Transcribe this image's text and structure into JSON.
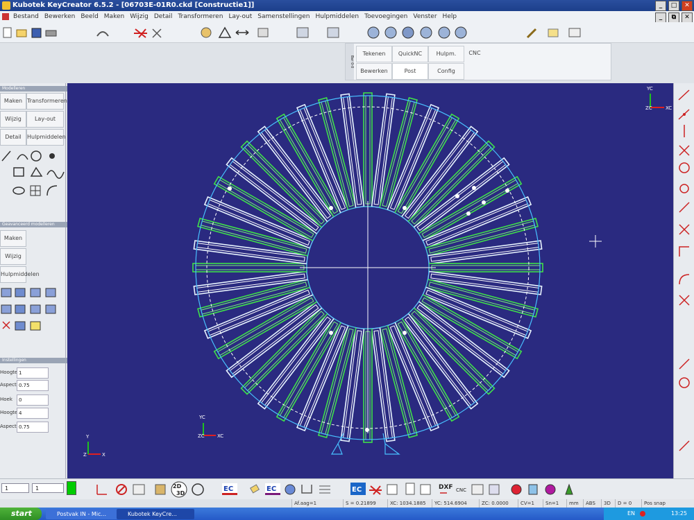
{
  "window": {
    "title": "Kubotek KeyCreator 6.5.2 - [06703E-01R0.ckd [Constructie1]]",
    "buttons": [
      "_",
      "□",
      "✕"
    ],
    "doc_buttons": [
      "_",
      "⧉",
      "✕"
    ]
  },
  "menu": [
    "Bestand",
    "Bewerken",
    "Beeld",
    "Maken",
    "Wijzig",
    "Detail",
    "Transformeren",
    "Lay-out",
    "Samenstellingen",
    "Hulpmiddelen",
    "Toevoegingen",
    "Venster",
    "Help"
  ],
  "tabs_panel": {
    "side_label": "Bar 0-0",
    "tabs": [
      "Tekenen",
      "QuickNC",
      "Hulpm.",
      "CNC",
      "Bewerken",
      "Post",
      "Config"
    ]
  },
  "left_panel": {
    "section1_title": "Modelleren",
    "section1_buttons": [
      "Maken",
      "Transformeren",
      "Wijzig",
      "Lay-out",
      "Detail",
      "Hulpmiddelen"
    ],
    "section2_title": "Geavanceerd modelleren",
    "section2_buttons": [
      "Maken",
      "Wijzig",
      "Hulpmiddelen"
    ],
    "section3_title": "Instellingen",
    "fields": [
      {
        "label": "Hoogte",
        "value": "1"
      },
      {
        "label": "Aspect",
        "value": "0.75"
      },
      {
        "label": "Hoek",
        "value": "0"
      },
      {
        "label": "Hoogte",
        "value": "4"
      },
      {
        "label": "Aspect",
        "value": "0.75"
      }
    ]
  },
  "canvas": {
    "axis_top": {
      "y": "YC",
      "z": "ZC",
      "x": "XC"
    },
    "axis_left": {
      "y": "YC",
      "z": "ZC",
      "x": "XC"
    },
    "axis_corner": {
      "y": "Y",
      "z": "Z",
      "x": "X"
    }
  },
  "bottom_toolbar": {
    "dropdown1": "1",
    "dropdown2": "1",
    "ec_label": "EC",
    "ec2_label": "EC",
    "ec3_label": "EC",
    "dxf_label": "DXF",
    "cnc_label": "CNC",
    "view_2d": "2D",
    "view_3d": "3D",
    "color_swatch": "#00cc00"
  },
  "status": {
    "layer": "Af.aag=1",
    "s": "S = 0.21899",
    "xc": "XC: 1034.1885",
    "yc": "YC: 514.6904",
    "zc": "ZC: 0.0000",
    "cv": "CV=1",
    "sn": "Sn=1",
    "units": "mm",
    "abs": "ABS",
    "mode": "3D",
    "d": "D = 0",
    "pos": "Pos snap"
  },
  "taskbar": {
    "start": "start",
    "task1": "Postvak IN - Mic...",
    "task2": "Kubotek KeyCre...",
    "lang": "EN",
    "time": "13:25"
  }
}
